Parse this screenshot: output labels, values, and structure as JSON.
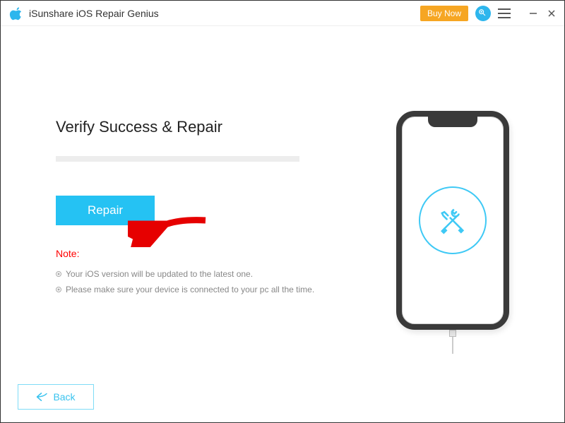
{
  "titlebar": {
    "app_name": "iSunshare iOS Repair Genius",
    "buy_now_label": "Buy Now"
  },
  "main": {
    "heading": "Verify Success & Repair",
    "repair_label": "Repair",
    "note_title": "Note:",
    "notes": [
      "Your iOS version will be updated to the latest one.",
      "Please make sure your device is connected to your pc all the time."
    ]
  },
  "footer": {
    "back_label": "Back"
  },
  "colors": {
    "accent": "#25c2f3",
    "buy_now": "#f6a623",
    "note_title": "#ff0000"
  }
}
